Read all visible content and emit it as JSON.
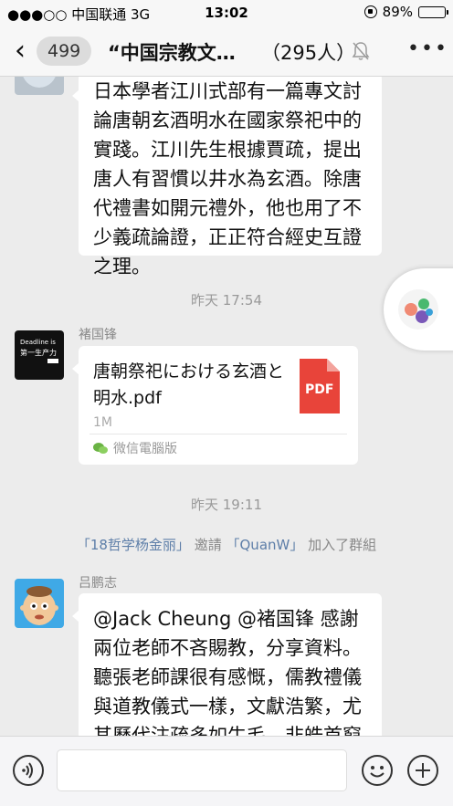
{
  "status_bar": {
    "carrier": "●●●○○ 中国联通  3G",
    "time": "13:02",
    "battery": "89%",
    "battery_level": 0.89
  },
  "nav": {
    "unread_count": "499",
    "title": "“中国宗教文…",
    "member_count": "（295人）"
  },
  "messages": {
    "first_text": "日本學者江川式部有一篇專文討論唐朝玄酒明水在國家祭祀中的實踐。江川先生根據賈疏，提出唐人有習慣以井水為玄酒。除唐代禮書如開元禮外，他也用了不少義疏論證，正正符合經史互證之理。",
    "time_1": "昨天 17:54",
    "sender_2": "褚国锋",
    "avatar_2_text_1": "Deadline is",
    "avatar_2_text_2": "第一生产力",
    "file_name": "唐朝祭祀における玄酒と明水.pdf",
    "file_size": "1M",
    "file_badge": "PDF",
    "file_source": "微信電腦版",
    "time_2": "昨天 19:11",
    "system_user_1": "「18哲学杨金丽」",
    "system_mid": "邀請",
    "system_user_2": "「QuanW」",
    "system_end": "加入了群組",
    "sender_3": "吕鹏志",
    "third_text": "@Jack Cheung @褚国锋 感謝兩位老師不吝賜教，分享資料。聽張老師課很有感慨，儒教禮儀與道教儀式一樣，文獻浩繁，尤其歷代注疏多如牛毛，非皓首窮經無法通曉。"
  },
  "colors": {
    "background": "#ececec",
    "pdf_red": "#e8443a",
    "link_blue": "#5d7ea8"
  }
}
